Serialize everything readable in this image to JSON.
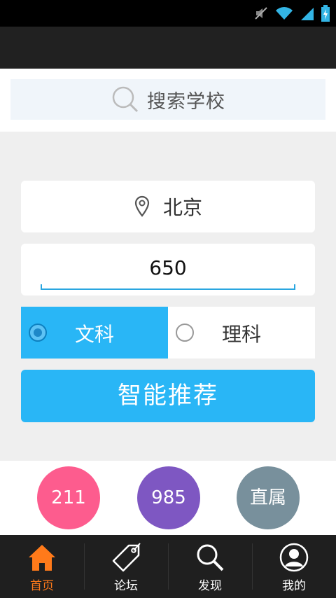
{
  "search": {
    "label": "搜索学校"
  },
  "location": {
    "city": "北京"
  },
  "score": {
    "value": "650"
  },
  "subject": {
    "options": [
      {
        "label": "文科",
        "selected": true
      },
      {
        "label": "理科",
        "selected": false
      }
    ]
  },
  "recommend": {
    "label": "智能推荐"
  },
  "categories": [
    {
      "label": "211",
      "color": "#fd5c8e"
    },
    {
      "label": "985",
      "color": "#7e57c2"
    },
    {
      "label": "直属",
      "color": "#78909c"
    }
  ],
  "tabs": [
    {
      "label": "首页",
      "icon": "home-icon",
      "active": true
    },
    {
      "label": "论坛",
      "icon": "tag-icon",
      "active": false
    },
    {
      "label": "发现",
      "icon": "search-icon",
      "active": false
    },
    {
      "label": "我的",
      "icon": "user-icon",
      "active": false
    }
  ],
  "colors": {
    "accent": "#29b6f6",
    "active_tab": "#ff7a1a",
    "appbar": "#212121"
  },
  "statusbar": {
    "icons": [
      "mute-icon",
      "wifi-icon",
      "signal-icon",
      "battery-icon"
    ]
  }
}
